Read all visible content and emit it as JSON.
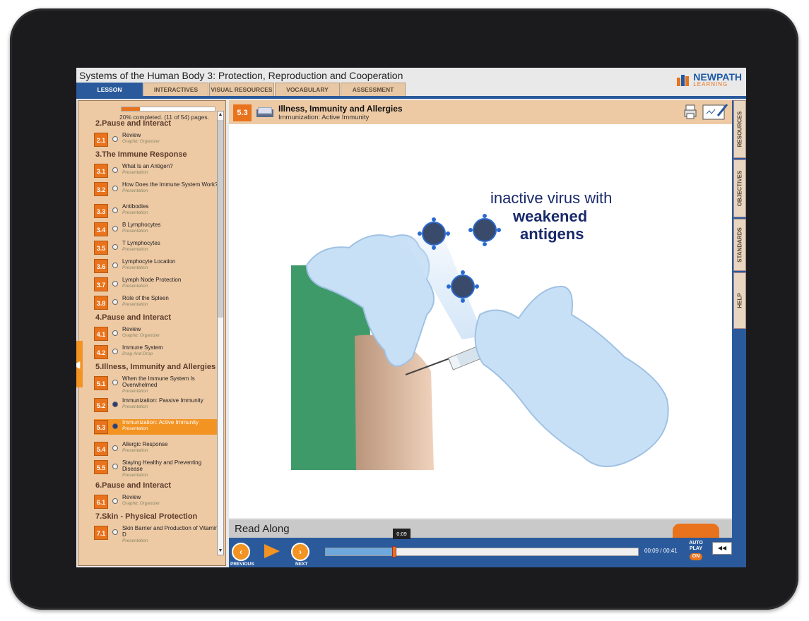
{
  "app": {
    "title": "Systems of the Human Body 3: Protection, Reproduction and Cooperation",
    "logo_text": "NEWPATH",
    "logo_sub": "LEARNING"
  },
  "tabs": [
    {
      "label": "LESSON",
      "active": true
    },
    {
      "label": "INTERACTIVES"
    },
    {
      "label": "VISUAL RESOURCES"
    },
    {
      "label": "VOCABULARY"
    },
    {
      "label": "ASSESSMENT"
    }
  ],
  "sidebar": {
    "progress_text": "20% completed. (11 of 54) pages.",
    "progress_fraction": 0.2,
    "sections": [
      {
        "title": "2.Pause and Interact",
        "items": [
          {
            "num": "2.1",
            "title": "Review",
            "type": "Graphic Organizer"
          }
        ]
      },
      {
        "title": "3.The Immune Response",
        "items": [
          {
            "num": "3.1",
            "title": "What Is an Antigen?",
            "type": "Presentation"
          },
          {
            "num": "3.2",
            "title": "How Does the Immune System Work?",
            "type": "Presentation"
          },
          {
            "num": "3.3",
            "title": "Antibodies",
            "type": "Presentation"
          },
          {
            "num": "3.4",
            "title": "B Lymphocytes",
            "type": "Presentation"
          },
          {
            "num": "3.5",
            "title": "T Lymphocytes",
            "type": "Presentation"
          },
          {
            "num": "3.6",
            "title": "Lymphocyte Location",
            "type": "Presentation"
          },
          {
            "num": "3.7",
            "title": "Lymph Node Protection",
            "type": "Presentation"
          },
          {
            "num": "3.8",
            "title": "Role of the Spleen",
            "type": "Presentation"
          }
        ]
      },
      {
        "title": "4.Pause and Interact",
        "items": [
          {
            "num": "4.1",
            "title": "Review",
            "type": "Graphic Organizer"
          },
          {
            "num": "4.2",
            "title": "Immune System",
            "type": "Drag And Drop"
          }
        ]
      },
      {
        "title": "5.Illness, Immunity and Allergies",
        "items": [
          {
            "num": "5.1",
            "title": "When the Immune System Is Overwhelmed",
            "type": "Presentation"
          },
          {
            "num": "5.2",
            "title": "Immunization: Passive Immunity",
            "type": "Presentation",
            "visited": true
          },
          {
            "num": "5.3",
            "title": "Immunization: Active Immunity",
            "type": "Presentation",
            "active": true
          },
          {
            "num": "5.4",
            "title": "Allergic Response",
            "type": "Presentation"
          },
          {
            "num": "5.5",
            "title": "Staying Healthy and Preventing Disease",
            "type": "Presentation"
          }
        ]
      },
      {
        "title": "6.Pause and Interact",
        "items": [
          {
            "num": "6.1",
            "title": "Review",
            "type": "Graphic Organizer"
          }
        ]
      },
      {
        "title": "7.Skin - Physical Protection",
        "items": [
          {
            "num": "7.1",
            "title": "Skin Barrier and Production of Vitamin D",
            "type": "Presentation"
          }
        ]
      }
    ]
  },
  "lesson": {
    "number": "5.3",
    "title": "Illness, Immunity and Allergies",
    "subtitle": "Immunization: Active Immunity",
    "caption_line1": "inactive virus with",
    "caption_line2": "weakened",
    "caption_line3": "antigens"
  },
  "side_tabs": [
    "RESOURCES",
    "OBJECTIVES",
    "STANDARDS",
    "HELP"
  ],
  "player": {
    "read_along": "Read Along",
    "previous_label": "PREVIOUS",
    "next_label": "NEXT",
    "tooltip": "0:09",
    "time": "00:09 / 00:41",
    "progress_fraction": 0.22,
    "autoplay_label": "AUTO PLAY",
    "autoplay_state": "ON"
  },
  "colors": {
    "accent": "#e8731c",
    "brand_blue": "#2a5a9c",
    "sidebar_bg": "#edc9a4",
    "caption": "#1a2a6a"
  }
}
